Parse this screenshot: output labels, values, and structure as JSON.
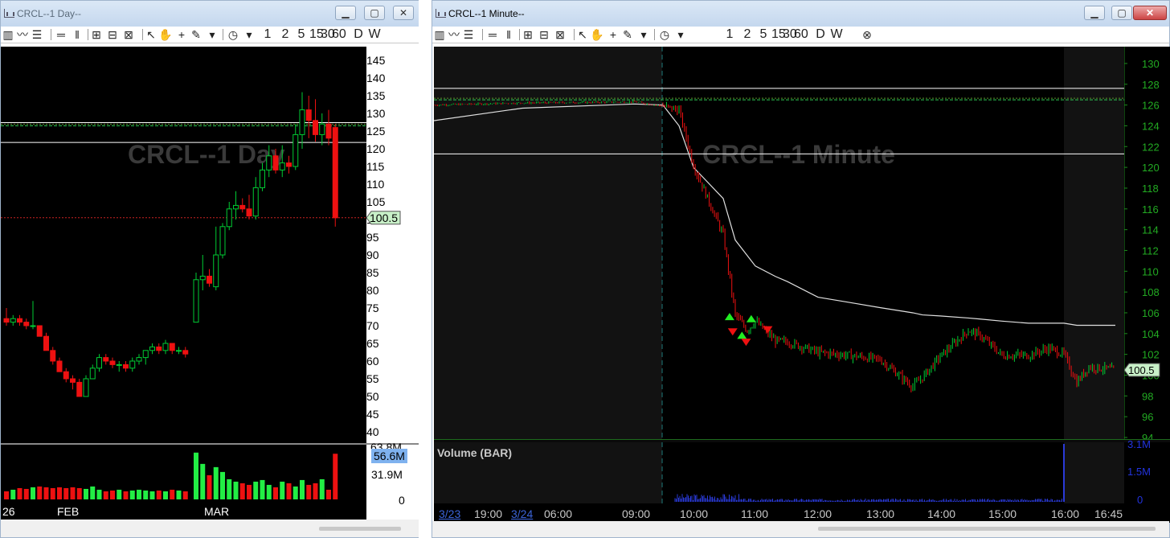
{
  "left_window": {
    "title": "CRCL--1 Day--",
    "watermark": "CRCL--1 Day",
    "toolbar_labels": [
      "1",
      "2",
      "5",
      "15",
      "30",
      "60",
      "D",
      "W"
    ],
    "price_axis": [
      "145",
      "140",
      "135",
      "130",
      "125",
      "120",
      "115",
      "110",
      "105",
      "100",
      "95",
      "90",
      "85",
      "80",
      "75",
      "70",
      "65",
      "60",
      "55",
      "50",
      "45",
      "40"
    ],
    "last_price_label": "100.5",
    "volume_labels": {
      "top_partial": "63.8M",
      "current": "56.6M",
      "mid": "31.9M",
      "zero": "0"
    },
    "time_labels": [
      "26",
      "FEB",
      "MAR"
    ]
  },
  "right_window": {
    "title": "CRCL--1 Minute--",
    "watermark": "CRCL--1 Minute",
    "toolbar_labels": [
      "1",
      "2",
      "5",
      "15",
      "30",
      "60",
      "D",
      "W"
    ],
    "price_axis": [
      "130",
      "128",
      "126",
      "124",
      "122",
      "120",
      "118",
      "116",
      "114",
      "112",
      "110",
      "108",
      "106",
      "104",
      "102",
      "100",
      "98",
      "96",
      "94"
    ],
    "last_price_label": "100.5",
    "volume_title": "Volume (BAR)",
    "volume_labels": [
      "3.1M",
      "1.5M",
      "0"
    ],
    "time_labels": [
      "3/23",
      "19:00",
      "3/24",
      "06:00",
      "09:00",
      "10:00",
      "11:00",
      "12:00",
      "13:00",
      "14:00",
      "15:00",
      "16:00",
      "16:45"
    ]
  },
  "colors": {
    "up_candle": "#00cc33",
    "down_candle": "#ee1111",
    "vwap_line": "#e0e0e0",
    "axis_text_right": "#22aa22",
    "volume_bar": "#2a3ad8",
    "titlebar": "#c4d7ee"
  },
  "chart_data": [
    {
      "type": "bar",
      "name": "CRCL daily candlesticks",
      "categories": [
        "26",
        "FEB",
        "MAR"
      ],
      "ohlc": [
        [
          72,
          75,
          70,
          71
        ],
        [
          71,
          73,
          70,
          72
        ],
        [
          72,
          73,
          70,
          71
        ],
        [
          71,
          72,
          69,
          70
        ],
        [
          70,
          77,
          69,
          70
        ],
        [
          70,
          70,
          67,
          67
        ],
        [
          67,
          68,
          63,
          63
        ],
        [
          63,
          64,
          59,
          60
        ],
        [
          60,
          61,
          57,
          57
        ],
        [
          57,
          58,
          54,
          55
        ],
        [
          55,
          56,
          52,
          54
        ],
        [
          54,
          55,
          50,
          50
        ],
        [
          50,
          56,
          50,
          55
        ],
        [
          55,
          59,
          55,
          58
        ],
        [
          58,
          62,
          57,
          61
        ],
        [
          61,
          62,
          59,
          60
        ],
        [
          60,
          61,
          58,
          59
        ],
        [
          59,
          60,
          57,
          59
        ],
        [
          59,
          60,
          57,
          58
        ],
        [
          58,
          61,
          57,
          60
        ],
        [
          60,
          62,
          59,
          61
        ],
        [
          61,
          63,
          59,
          63
        ],
        [
          63,
          65,
          62,
          64
        ],
        [
          64,
          65,
          62,
          63
        ],
        [
          63,
          66,
          62,
          65
        ],
        [
          65,
          65,
          62,
          63
        ],
        [
          63,
          64,
          62,
          63
        ],
        [
          63,
          64,
          61,
          62
        ],
        [
          71,
          85,
          71,
          83
        ],
        [
          83,
          90,
          80,
          84
        ],
        [
          84,
          86,
          81,
          82
        ],
        [
          81,
          98,
          80,
          90
        ],
        [
          90,
          99,
          89,
          98
        ],
        [
          98,
          105,
          97,
          103
        ],
        [
          103,
          108,
          100,
          104
        ],
        [
          104,
          106,
          102,
          103
        ],
        [
          103,
          107,
          100,
          101
        ],
        [
          101,
          112,
          100,
          109
        ],
        [
          109,
          116,
          108,
          114
        ],
        [
          114,
          121,
          112,
          118
        ],
        [
          118,
          120,
          113,
          114
        ],
        [
          114,
          121,
          112,
          116
        ],
        [
          116,
          118,
          113,
          115
        ],
        [
          115,
          127,
          114,
          124
        ],
        [
          124,
          136,
          120,
          131
        ],
        [
          131,
          135,
          123,
          128
        ],
        [
          128,
          134,
          122,
          124
        ],
        [
          124,
          130,
          121,
          127
        ],
        [
          127,
          131,
          121,
          123
        ],
        [
          126,
          127,
          98,
          100.5
        ]
      ],
      "volume_m": [
        10,
        12,
        14,
        13,
        15,
        16,
        15,
        14,
        15,
        14,
        15,
        14,
        13,
        16,
        12,
        10,
        11,
        12,
        10,
        11,
        12,
        11,
        10,
        11,
        10,
        12,
        11,
        10,
        58,
        44,
        30,
        40,
        34,
        25,
        22,
        20,
        18,
        22,
        24,
        18,
        15,
        22,
        20,
        16,
        24,
        18,
        20,
        25,
        12,
        56.6
      ],
      "ylim": [
        40,
        145
      ],
      "last_price": 100.5,
      "horizontal_levels": [
        126.5,
        127.4,
        121.8,
        100.5
      ]
    },
    {
      "type": "line",
      "name": "CRCL 1-minute price",
      "x": [
        "3/23 18:00",
        "3/24 06:00",
        "09:00",
        "09:30",
        "09:45",
        "10:00",
        "10:15",
        "10:30",
        "10:45",
        "11:00",
        "11:15",
        "11:30",
        "12:00",
        "12:30",
        "13:00",
        "13:30",
        "13:45",
        "14:00",
        "14:30",
        "14:45",
        "15:00",
        "15:30",
        "15:45",
        "16:00",
        "16:15",
        "16:30",
        "16:45"
      ],
      "series": [
        {
          "values": [
            126.0,
            126.2,
            126.3,
            125.9,
            125.5,
            120.2,
            113.5,
            105.8,
            104.3,
            105.2,
            103.3,
            103.2,
            102.2,
            101.9,
            101.5,
            98.9,
            99.8,
            101.8,
            104.3,
            103.8,
            101.9,
            101.9,
            102.6,
            102.0,
            99.3,
            100.8,
            100.5
          ]
        },
        {
          "values": [
            124.5,
            125.7,
            126.1,
            126.0,
            124.0,
            120.0,
            117.0,
            113.0,
            111.5,
            110.5,
            109.5,
            109.0,
            107.5,
            107.0,
            106.5,
            106.0,
            105.8,
            105.7,
            105.5,
            105.4,
            105.2,
            105.0,
            105.0,
            105.0,
            104.8,
            104.8,
            104.8
          ]
        }
      ],
      "ylim": [
        94,
        131
      ],
      "last_price": 100.5,
      "horizontal_levels": [
        127.6,
        126.5,
        121.3,
        100.5
      ],
      "signals": [
        {
          "time": "10:35",
          "type": "buy",
          "price": 105.6
        },
        {
          "time": "10:38",
          "type": "sell",
          "price": 104.2
        },
        {
          "time": "10:47",
          "type": "buy",
          "price": 103.8
        },
        {
          "time": "10:51",
          "type": "sell",
          "price": 103.2
        },
        {
          "time": "10:56",
          "type": "buy",
          "price": 105.4
        },
        {
          "time": "11:12",
          "type": "sell",
          "price": 104.4
        }
      ],
      "volume": {
        "ylim": [
          0,
          3.1
        ],
        "spike_time": "16:00",
        "spike_value": 3.1
      }
    }
  ]
}
